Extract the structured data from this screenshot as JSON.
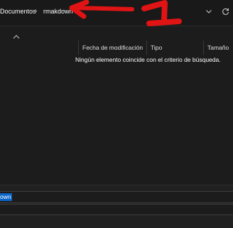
{
  "address_bar": {
    "breadcrumb": [
      "Documentos",
      "rmakdown"
    ],
    "separator": "›",
    "chevron_icon": "chevron-down-icon",
    "refresh_icon": "refresh-icon"
  },
  "annotation": {
    "text": "1",
    "color": "#e01414"
  },
  "file_list": {
    "columns": [
      "Fecha de modificación",
      "Tipo",
      "Tamaño"
    ],
    "empty_message": "Ningún elemento coincide con el criterio de búsqueda."
  },
  "save_bar": {
    "filename_value": "own",
    "selection_color": "#0a64c8"
  }
}
